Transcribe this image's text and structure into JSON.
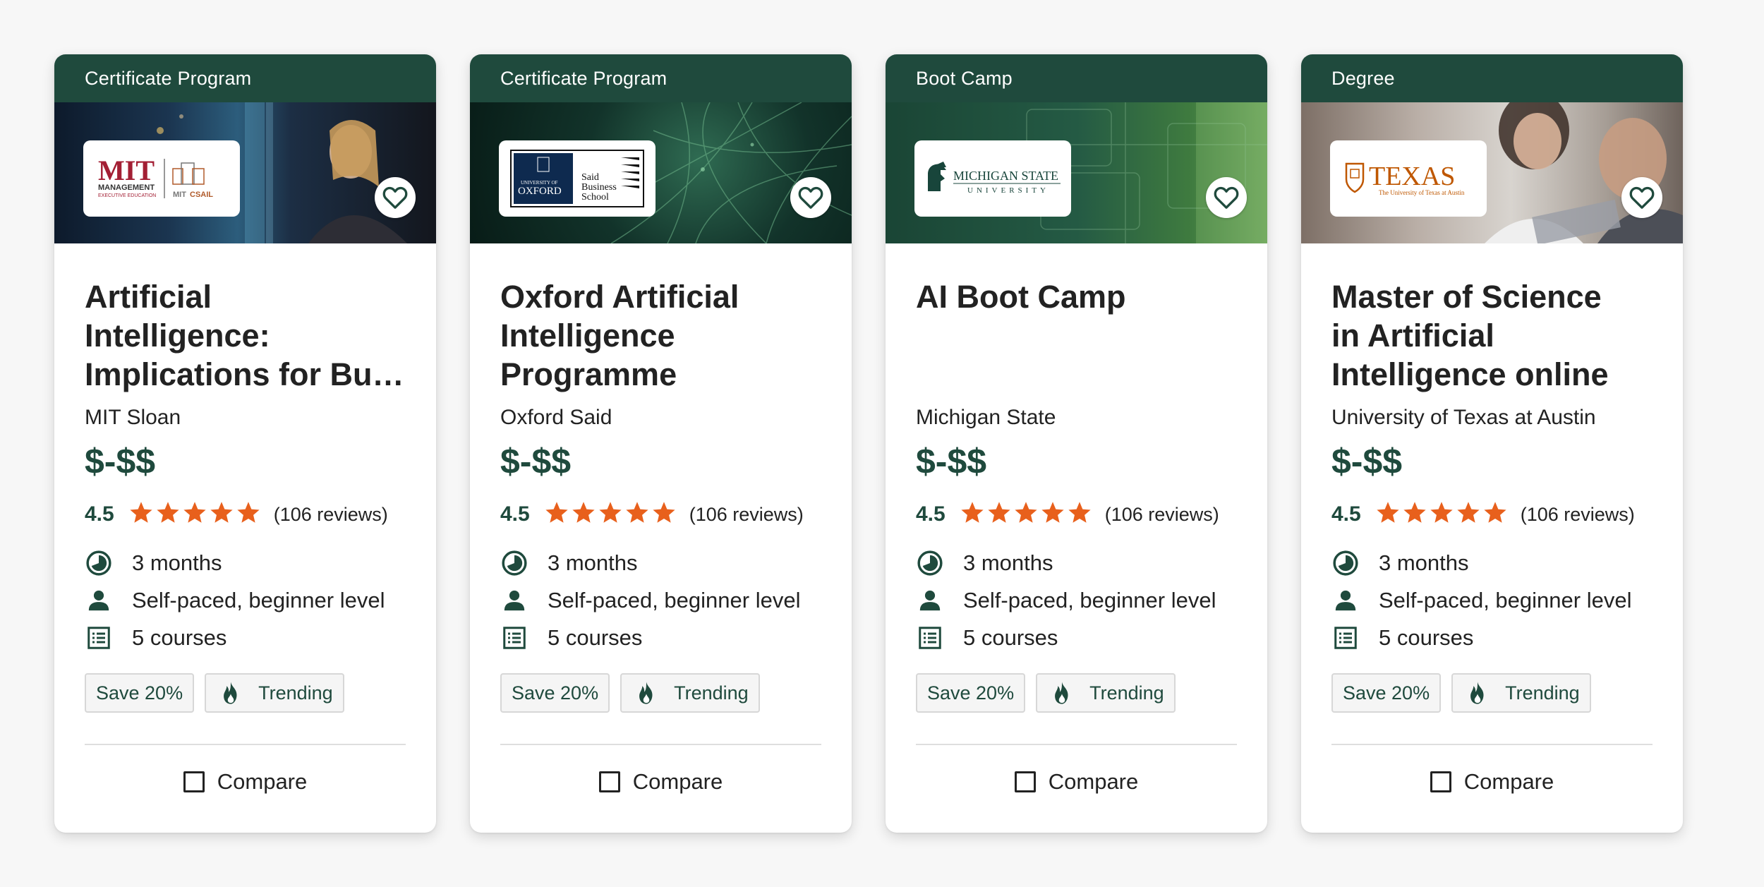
{
  "cards": [
    {
      "tag": "Certificate Program",
      "logo_text": "MIT MANAGEMENT EXECUTIVE EDUCATION | MIT CSAIL",
      "title_lines": [
        "Artificial",
        "Intelligence:",
        "Implications for Bu…"
      ],
      "provider": "MIT Sloan",
      "price": "$-$$",
      "rating": "4.5",
      "stars": 5,
      "reviews": "(106 reviews)",
      "duration": "3 months",
      "pace": "Self-paced, beginner level",
      "courses": "5 courses",
      "badge_save": "Save 20%",
      "badge_trending": "Trending",
      "compare": "Compare"
    },
    {
      "tag": "Certificate Program",
      "logo_text": "UNIVERSITY OF OXFORD | Said Business School",
      "title_lines": [
        "Oxford Artificial",
        "Intelligence",
        "Programme"
      ],
      "provider": "Oxford Said",
      "price": "$-$$",
      "rating": "4.5",
      "stars": 5,
      "reviews": "(106 reviews)",
      "duration": "3 months",
      "pace": "Self-paced, beginner level",
      "courses": "5 courses",
      "badge_save": "Save 20%",
      "badge_trending": "Trending",
      "compare": "Compare"
    },
    {
      "tag": "Boot Camp",
      "logo_text": "MICHIGAN STATE UNIVERSITY",
      "title_lines": [
        "AI Boot Camp",
        "",
        ""
      ],
      "provider": "Michigan State",
      "price": "$-$$",
      "rating": "4.5",
      "stars": 5,
      "reviews": "(106 reviews)",
      "duration": "3 months",
      "pace": "Self-paced, beginner level",
      "courses": "5 courses",
      "badge_save": "Save 20%",
      "badge_trending": "Trending",
      "compare": "Compare"
    },
    {
      "tag": "Degree",
      "logo_text": "TEXAS The University of Texas at Austin",
      "title_lines": [
        "Master of Science",
        "in Artificial",
        "Intelligence online"
      ],
      "provider": "University of Texas at Austin",
      "price": "$-$$",
      "rating": "4.5",
      "stars": 5,
      "reviews": "(106 reviews)",
      "duration": "3 months",
      "pace": "Self-paced, beginner level",
      "courses": "5 courses",
      "badge_save": "Save 20%",
      "badge_trending": "Trending",
      "compare": "Compare"
    }
  ],
  "colors": {
    "brand_green": "#1f4a3d",
    "star_orange": "#e8601c",
    "mit_red": "#a31f34",
    "texas_orange": "#bf5700",
    "msu_green": "#18453b",
    "oxford_navy": "#0e2a4f"
  },
  "icons": {
    "favorite": "heart-outline-icon",
    "duration": "clock-pie-icon",
    "pace": "person-icon",
    "courses": "list-icon",
    "trending": "flame-icon",
    "compare": "checkbox-icon"
  }
}
